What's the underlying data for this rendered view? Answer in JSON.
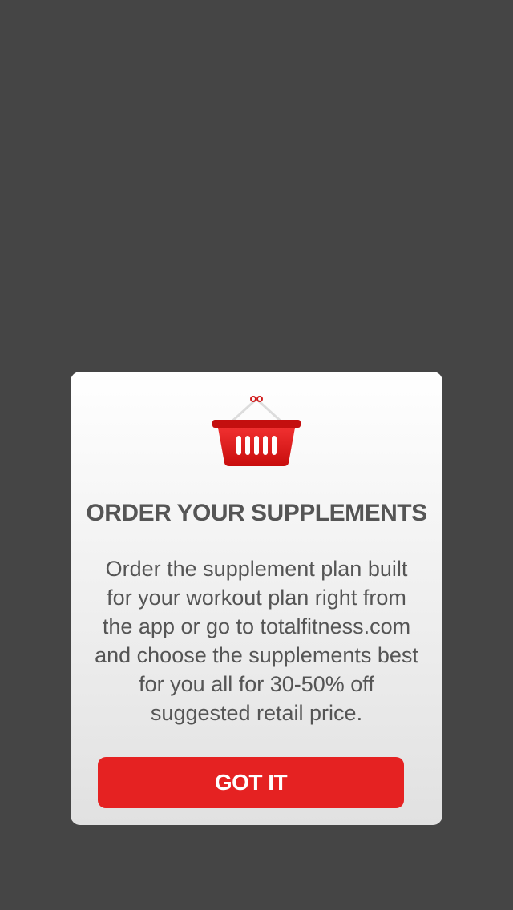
{
  "dialog": {
    "icon": "shopping-basket-icon",
    "title": "ORDER YOUR SUPPLEMENTS",
    "body_lines": [
      "Order the supplement plan built",
      "for your workout plan right from",
      "the app or go to totalfitness.com",
      "and  choose the supplements best",
      "for you all  for 30-50% off",
      "suggested  retail price."
    ],
    "button_label": "GOT IT"
  },
  "colors": {
    "backdrop": "#454545",
    "accent": "#e52222",
    "text": "#555555"
  }
}
